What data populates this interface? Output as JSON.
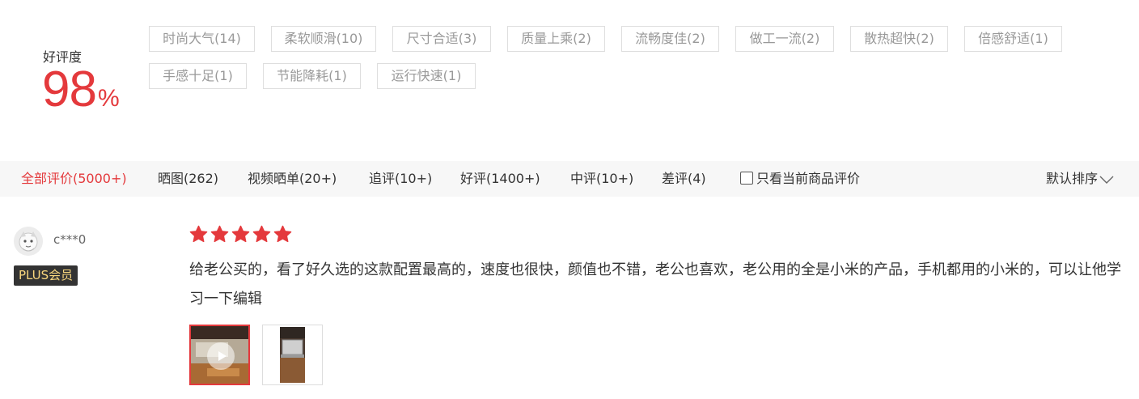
{
  "summary": {
    "label": "好评度",
    "value": "98",
    "unit": "%",
    "tags": [
      "时尚大气(14)",
      "柔软顺滑(10)",
      "尺寸合适(3)",
      "质量上乘(2)",
      "流畅度佳(2)",
      "做工一流(2)",
      "散热超快(2)",
      "倍感舒适(1)",
      "手感十足(1)",
      "节能降耗(1)",
      "运行快速(1)"
    ]
  },
  "filters": {
    "items": [
      "全部评价(5000+)",
      "晒图(262)",
      "视频晒单(20+)",
      "追评(10+)",
      "好评(1400+)",
      "中评(10+)",
      "差评(4)"
    ],
    "active_index": 0,
    "checkbox_label": "只看当前商品评价",
    "checkbox_checked": false,
    "sort_label": "默认排序"
  },
  "review": {
    "username": "c***0",
    "badge": "PLUS会员",
    "stars": 5,
    "text": "给老公买的，看了好久选的这款配置最高的，速度也很快，颜值也不错，老公也喜欢，老公用的全是小米的产品，手机都用的小米的，可以让他学习一下编辑",
    "media": [
      "video-thumbnail",
      "photo-thumbnail"
    ]
  },
  "colors": {
    "accent": "#e4393c",
    "tag_border": "#dedede",
    "tag_text": "#999999",
    "filter_bg": "#f7f7f7",
    "badge_bg": "#333333",
    "badge_text": "#f9d77e"
  },
  "icons": {
    "sort": "chevron-down-icon",
    "star": "star-icon",
    "play": "play-icon",
    "avatar": "avatar-icon"
  }
}
